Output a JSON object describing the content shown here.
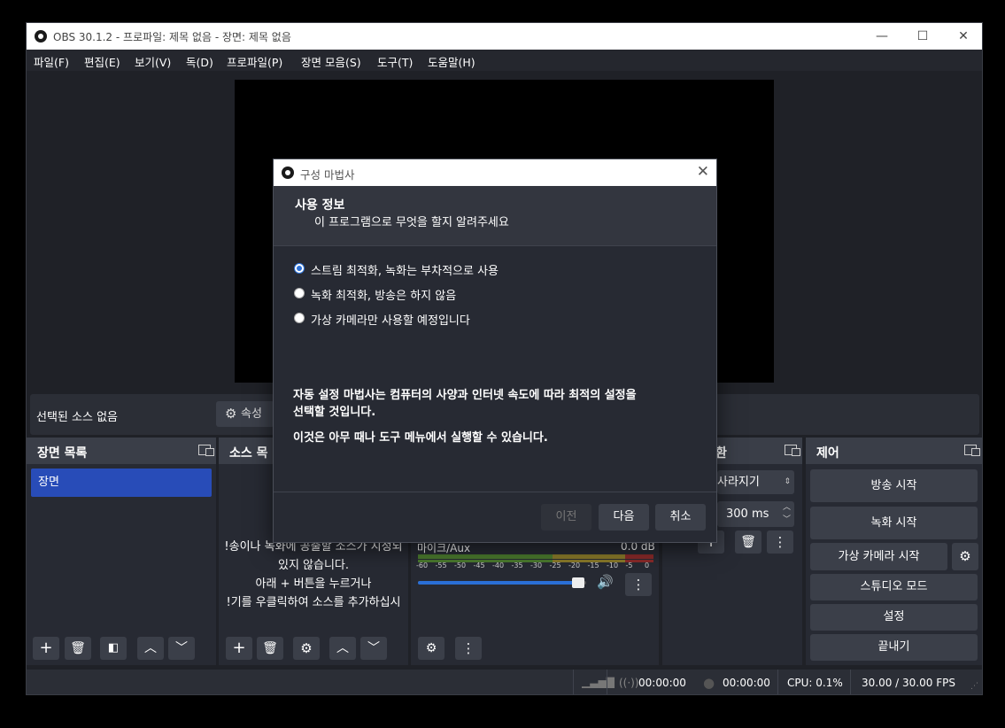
{
  "window": {
    "title": "OBS 30.1.2 - 프로파일: 제목 없음 - 장면: 제목 없음",
    "minimize": "—",
    "maximize": "☐",
    "close": "✕"
  },
  "menu": [
    "파일(F)",
    "편집(E)",
    "보기(V)",
    "독(D)",
    "프로파일(P)",
    "장면 모음(S)",
    "도구(T)",
    "도움말(H)"
  ],
  "properties_bar": {
    "no_source": "선택된 소스 없음",
    "properties_label": "속성"
  },
  "scenes": {
    "title": "장면 목록",
    "items": [
      "장면"
    ]
  },
  "sources": {
    "title": "소스 목",
    "hint": [
      "!송이나 녹화에 공출할 소스가 지정되",
      "있지 않습니다.",
      "아래 + 버튼을 누르거나",
      "!기를 우클릭하여 소스를 추가하십시"
    ]
  },
  "mixer": {
    "channel": "마이크/Aux",
    "level": "0.0 dB",
    "scale": [
      "-60",
      "-55",
      "-50",
      "-45",
      "-40",
      "-35",
      "-30",
      "-25",
      "-20",
      "-15",
      "-10",
      "-5",
      "0"
    ],
    "volume": 0.97
  },
  "transitions": {
    "title": "환",
    "type": "사라지기",
    "duration": "300 ms"
  },
  "controls": {
    "title": "제어",
    "start_streaming": "방송 시작",
    "start_recording": "녹화 시작",
    "start_virtual_camera": "가상 카메라 시작",
    "studio_mode": "스튜디오 모드",
    "settings": "설정",
    "exit": "끝내기"
  },
  "status": {
    "stream_time": "00:00:00",
    "record_time": "00:00:00",
    "cpu": "CPU: 0.1%",
    "fps": "30.00 / 30.00 FPS"
  },
  "dialog": {
    "title": "구성 마법사",
    "heading": "사용 정보",
    "subheading": "이 프로그램으로 무엇을 할지 알려주세요",
    "options": [
      {
        "label": "스트림 최적화, 녹화는 부차적으로 사용",
        "checked": true
      },
      {
        "label": "녹화 최적화, 방송은 하지 않음",
        "checked": false
      },
      {
        "label": "가상 카메라만 사용할 예정입니다",
        "checked": false
      }
    ],
    "description_1a": "자동 설정 마법사는 컴퓨터의 사양과 인터넷 속도에 따라 최적의 설정을",
    "description_1b": "선택할 것입니다.",
    "description_2": "이것은 아무 때나 도구 메뉴에서 실행할 수 있습니다.",
    "back": "이전",
    "next": "다음",
    "cancel": "취소"
  }
}
